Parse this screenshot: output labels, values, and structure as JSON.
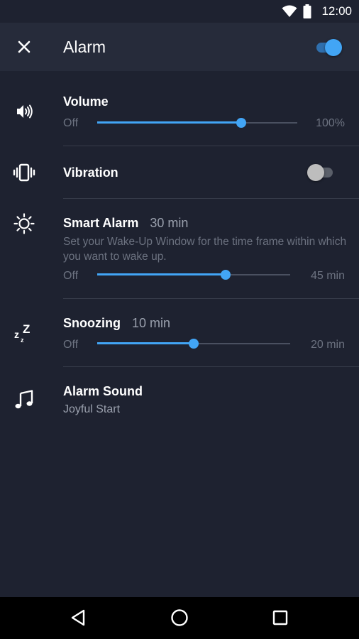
{
  "status_bar": {
    "time": "12:00"
  },
  "app_bar": {
    "title": "Alarm",
    "enabled": true
  },
  "rows": {
    "volume": {
      "title": "Volume",
      "min_label": "Off",
      "max_label": "100%",
      "level": 0.72
    },
    "vibration": {
      "title": "Vibration",
      "enabled": false
    },
    "smart_alarm": {
      "title": "Smart Alarm",
      "value": "30 min",
      "description": "Set your Wake-Up Window for the time frame within which you want to wake up.",
      "min_label": "Off",
      "max_label": "45 min",
      "level": 0.667
    },
    "snoozing": {
      "title": "Snoozing",
      "value": "10 min",
      "min_label": "Off",
      "max_label": "20 min",
      "level": 0.5
    },
    "alarm_sound": {
      "title": "Alarm Sound",
      "value": "Joyful Start"
    }
  },
  "icons": {
    "close": "close-icon",
    "volume": "volume-icon",
    "vibration": "vibration-icon",
    "smart_alarm": "sun-icon",
    "snoozing": "snooze-zzz-icon",
    "alarm_sound": "music-note-icon",
    "wifi": "wifi-icon",
    "battery": "battery-icon",
    "back": "back-triangle-icon",
    "home": "home-circle-icon",
    "recents": "recents-square-icon"
  },
  "colors": {
    "accent": "#42a5f5",
    "background": "#1e2230",
    "app_bar": "#262b3a"
  }
}
